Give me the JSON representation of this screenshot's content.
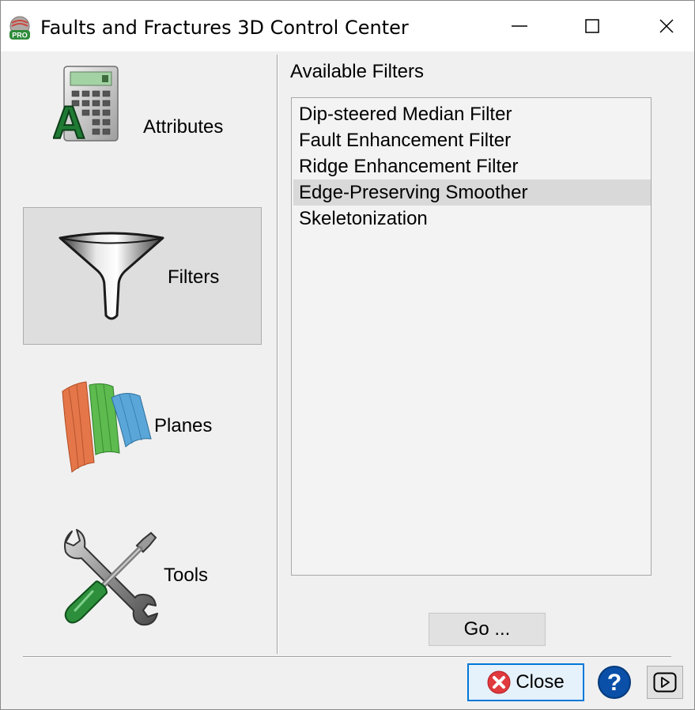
{
  "window": {
    "title": "Faults and Fractures 3D Control Center",
    "app_icon": "pro-badge-icon",
    "controls": [
      "minimize",
      "maximize",
      "close"
    ]
  },
  "sidebar": {
    "items": [
      {
        "label": "Attributes",
        "icon": "calculator-icon",
        "active": false
      },
      {
        "label": "Filters",
        "icon": "funnel-icon",
        "active": true
      },
      {
        "label": "Planes",
        "icon": "planes-icon",
        "active": false
      },
      {
        "label": "Tools",
        "icon": "wrench-screwdriver-icon",
        "active": false
      }
    ]
  },
  "filters": {
    "heading": "Available Filters",
    "items": [
      {
        "label": "Dip-steered Median Filter",
        "selected": false
      },
      {
        "label": "Fault Enhancement Filter",
        "selected": false
      },
      {
        "label": "Ridge Enhancement Filter",
        "selected": false
      },
      {
        "label": "Edge-Preserving Smoother",
        "selected": true
      },
      {
        "label": "Skeletonization",
        "selected": false
      }
    ],
    "go_label": "Go ..."
  },
  "footer": {
    "close_label": "Close",
    "help_label": "?",
    "close_icon": "x-circle-icon",
    "help_icon": "question-icon",
    "play_icon": "play-icon"
  },
  "colors": {
    "selection": "#d9d9d9",
    "focus_border": "#0078d7",
    "help_blue": "#0a50a8",
    "close_red": "#e0393e"
  }
}
